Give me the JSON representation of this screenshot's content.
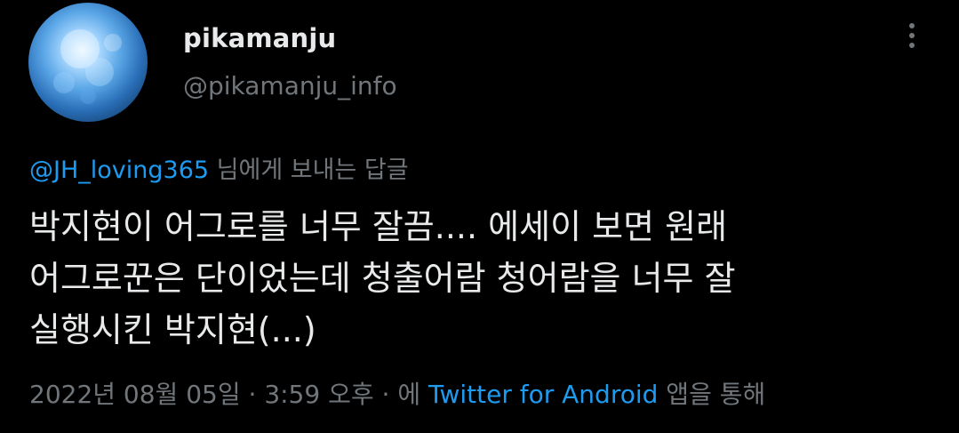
{
  "author": {
    "display_name": "pikamanju",
    "handle": "@pikamanju_info",
    "avatar_icon": "moon-avatar"
  },
  "reply": {
    "mention": "@JH_loving365",
    "suffix": " 님에게 보내는 답글"
  },
  "tweet": {
    "lines": [
      "박지현이 어그로를 너무 잘끔.... 에세이 보면 원래",
      "어그로꾼은 단이었는데 청출어람 청어람을 너무 잘",
      "실행시킨 박지현(...)"
    ]
  },
  "meta": {
    "date": "2022년 08월 05일",
    "separator1": " · ",
    "time": "3:59 오후",
    "separator2": " · ",
    "prefix": "에 ",
    "source": "Twitter for Android",
    "suffix": " 앱을 통해"
  },
  "icons": {
    "more": "more-vertical-icon"
  },
  "colors": {
    "background": "#000000",
    "text": "#e7e9ea",
    "secondary": "#71767b",
    "link": "#1d9bf0"
  }
}
